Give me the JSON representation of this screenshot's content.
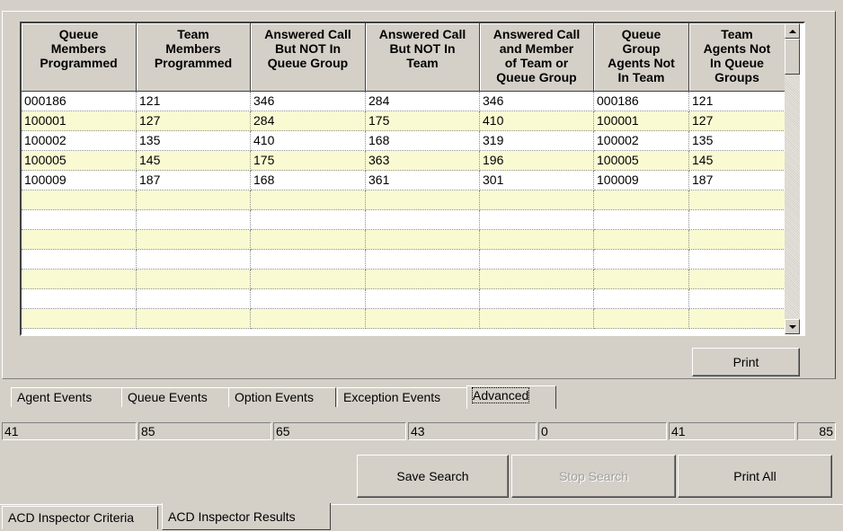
{
  "grid": {
    "columns": [
      {
        "label": "Queue Members Programmed",
        "lines": [
          "Queue",
          "Members",
          "Programmed"
        ]
      },
      {
        "label": "Team Members Programmed",
        "lines": [
          "Team",
          "Members",
          "Programmed"
        ]
      },
      {
        "label": "Answered Call But NOT In Queue Group",
        "lines": [
          "Answered Call",
          "But NOT In",
          "Queue Group"
        ]
      },
      {
        "label": "Answered Call But NOT In Team",
        "lines": [
          "Answered Call",
          "But NOT In",
          "Team"
        ]
      },
      {
        "label": "Answered Call and Member of Team or Queue Group",
        "lines": [
          "Answered Call",
          "and Member",
          "of Team or",
          "Queue Group"
        ]
      },
      {
        "label": "Queue Group Agents Not In Team",
        "lines": [
          "Queue",
          "Group",
          "Agents Not",
          "In Team"
        ]
      },
      {
        "label": "Team Agents Not In Queue Groups",
        "lines": [
          "Team",
          "Agents Not",
          "In Queue",
          "Groups"
        ]
      }
    ],
    "rows": [
      [
        "000186",
        "121",
        "346",
        "284",
        "346",
        "000186",
        "121"
      ],
      [
        "100001",
        "127",
        "284",
        "175",
        "410",
        "100001",
        "127"
      ],
      [
        "100002",
        "135",
        "410",
        "168",
        "319",
        "100002",
        "135"
      ],
      [
        "100005",
        "145",
        "175",
        "363",
        "196",
        "100005",
        "145"
      ],
      [
        "100009",
        "187",
        "168",
        "361",
        "301",
        "100009",
        "187"
      ],
      [
        "",
        "",
        "",
        "",
        "",
        "",
        ""
      ],
      [
        "",
        "",
        "",
        "",
        "",
        "",
        ""
      ],
      [
        "",
        "",
        "",
        "",
        "",
        "",
        ""
      ],
      [
        "",
        "",
        "",
        "",
        "",
        "",
        ""
      ],
      [
        "",
        "",
        "",
        "",
        "",
        "",
        ""
      ],
      [
        "",
        "",
        "",
        "",
        "",
        "",
        ""
      ],
      [
        "",
        "",
        "",
        "",
        "",
        "",
        ""
      ]
    ],
    "alt_row_color": "#fafad2"
  },
  "print_button": "Print",
  "inner_tabs": [
    "Agent Events",
    "Queue Events",
    "Option Events",
    "Exception Events",
    "Advanced"
  ],
  "inner_tab_active": "Advanced",
  "status_fields": [
    "41",
    "85",
    "65",
    "43",
    "0",
    "41",
    "85"
  ],
  "buttons": {
    "save_search": "Save Search",
    "stop_search": "Stop Search",
    "print_all": "Print All"
  },
  "outer_tabs": [
    "ACD Inspector Criteria",
    "ACD Inspector Results"
  ],
  "outer_tab_active": "ACD Inspector Results"
}
